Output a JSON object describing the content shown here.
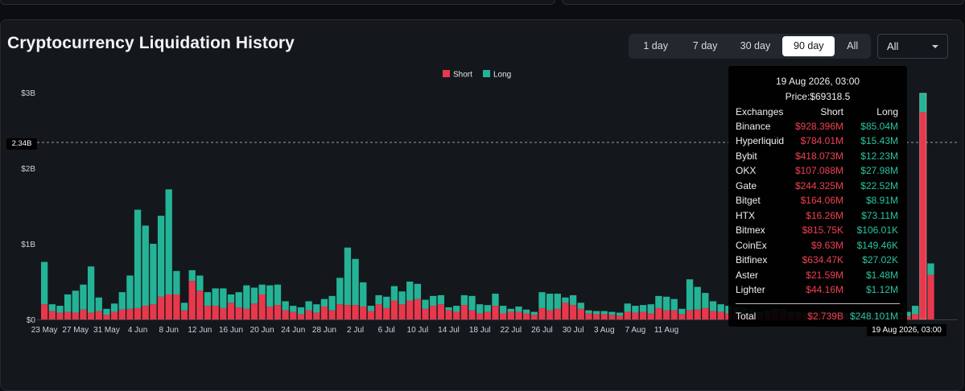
{
  "title": "Cryptocurrency Liquidation History",
  "range_buttons": [
    "1 day",
    "7 day",
    "30 day",
    "90 day",
    "All"
  ],
  "active_range": "90 day",
  "exchange_select": "All",
  "colors": {
    "short": "#e8384c",
    "long": "#24b396"
  },
  "crosshair_label": "2.34B",
  "crosshair_date": "19 Aug 2026, 03:00",
  "tooltip": {
    "date": "19 Aug 2026, 03:00",
    "price": "Price:$69318.5",
    "col_exchange": "Exchanges",
    "col_short": "Short",
    "col_long": "Long",
    "rows": [
      {
        "exchange": "Binance",
        "short": "$928.396M",
        "long": "$85.04M"
      },
      {
        "exchange": "Hyperliquid",
        "short": "$784.01M",
        "long": "$15.43M"
      },
      {
        "exchange": "Bybit",
        "short": "$418.073M",
        "long": "$12.23M"
      },
      {
        "exchange": "OKX",
        "short": "$107.088M",
        "long": "$27.98M"
      },
      {
        "exchange": "Gate",
        "short": "$244.325M",
        "long": "$22.52M"
      },
      {
        "exchange": "Bitget",
        "short": "$164.06M",
        "long": "$8.91M"
      },
      {
        "exchange": "HTX",
        "short": "$16.26M",
        "long": "$73.11M"
      },
      {
        "exchange": "Bitmex",
        "short": "$815.75K",
        "long": "$106.01K"
      },
      {
        "exchange": "CoinEx",
        "short": "$9.63M",
        "long": "$149.46K"
      },
      {
        "exchange": "Bitfinex",
        "short": "$634.47K",
        "long": "$27.02K"
      },
      {
        "exchange": "Aster",
        "short": "$21.59M",
        "long": "$1.48M"
      },
      {
        "exchange": "Lighter",
        "short": "$44.16M",
        "long": "$1.12M"
      }
    ],
    "total_label": "Total",
    "total_short": "$2.739B",
    "total_long": "$248.101M"
  },
  "chart_data": {
    "type": "bar",
    "stacked": true,
    "legend": {
      "position": "top-center",
      "entries": [
        "Short",
        "Long"
      ]
    },
    "y_ticks": [
      "$0",
      "$1B",
      "$2B",
      "$3B"
    ],
    "ylim": [
      0,
      3.0
    ],
    "y_unit": "USD billions",
    "x_tick_labels": [
      "23 May",
      "27 May",
      "31 May",
      "4 Jun",
      "8 Jun",
      "12 Jun",
      "16 Jun",
      "20 Jun",
      "24 Jun",
      "28 Jun",
      "2 Jul",
      "6 Jul",
      "10 Jul",
      "14 Jul",
      "18 Jul",
      "22 Jul",
      "26 Jul",
      "30 Jul",
      "3 Aug",
      "7 Aug",
      "11 Aug"
    ],
    "x_tick_every": 4,
    "series": [
      {
        "name": "Short",
        "values": [
          0.2,
          0.11,
          0.09,
          0.1,
          0.09,
          0.13,
          0.09,
          0.11,
          0.06,
          0.1,
          0.13,
          0.14,
          0.15,
          0.18,
          0.2,
          0.3,
          0.33,
          0.33,
          0.12,
          0.51,
          0.38,
          0.18,
          0.18,
          0.15,
          0.22,
          0.16,
          0.14,
          0.21,
          0.33,
          0.17,
          0.19,
          0.12,
          0.1,
          0.07,
          0.12,
          0.09,
          0.17,
          0.12,
          0.2,
          0.19,
          0.19,
          0.17,
          0.11,
          0.2,
          0.15,
          0.25,
          0.2,
          0.25,
          0.27,
          0.14,
          0.18,
          0.2,
          0.12,
          0.1,
          0.19,
          0.12,
          0.08,
          0.1,
          0.18,
          0.08,
          0.1,
          0.1,
          0.08,
          0.06,
          0.15,
          0.12,
          0.14,
          0.22,
          0.19,
          0.14,
          0.08,
          0.07,
          0.07,
          0.06,
          0.05,
          0.1,
          0.09,
          0.1,
          0.08,
          0.15,
          0.12,
          0.12,
          0.07,
          0.12,
          0.13,
          0.15,
          0.11,
          0.1,
          0.08,
          0.1,
          0.1,
          0.08,
          0.06,
          0.08,
          0.1,
          0.1,
          0.06,
          0.05,
          0.05,
          0.05,
          0.07,
          0.05,
          0.04,
          0.04,
          0.05,
          0.05,
          0.05,
          0.04,
          0.04,
          0.05,
          0.05,
          0.04,
          0.07,
          2.74,
          0.59
        ]
      },
      {
        "name": "Long",
        "values": [
          0.56,
          0.09,
          0.09,
          0.23,
          0.29,
          0.33,
          0.61,
          0.18,
          0.08,
          0.11,
          0.23,
          0.44,
          1.3,
          1.06,
          0.8,
          1.07,
          1.39,
          0.31,
          0.1,
          0.14,
          0.2,
          0.18,
          0.23,
          0.26,
          0.11,
          0.2,
          0.31,
          0.21,
          0.13,
          0.28,
          0.27,
          0.12,
          0.08,
          0.09,
          0.12,
          0.11,
          0.1,
          0.19,
          0.35,
          0.76,
          0.61,
          0.32,
          0.07,
          0.12,
          0.15,
          0.19,
          0.17,
          0.25,
          0.2,
          0.12,
          0.13,
          0.12,
          0.04,
          0.08,
          0.13,
          0.19,
          0.12,
          0.09,
          0.16,
          0.1,
          0.04,
          0.07,
          0.05,
          0.04,
          0.21,
          0.22,
          0.2,
          0.07,
          0.13,
          0.08,
          0.04,
          0.04,
          0.04,
          0.04,
          0.04,
          0.11,
          0.09,
          0.09,
          0.12,
          0.16,
          0.18,
          0.15,
          0.07,
          0.41,
          0.3,
          0.2,
          0.13,
          0.1,
          0.1,
          0.06,
          0.05,
          0.05,
          0.04,
          0.04,
          0.04,
          0.04,
          0.04,
          0.05,
          0.04,
          0.04,
          0.04,
          0.04,
          0.05,
          0.05,
          0.04,
          0.05,
          0.04,
          0.05,
          0.04,
          0.04,
          0.04,
          0.06,
          0.11,
          0.25,
          0.15
        ]
      }
    ]
  }
}
